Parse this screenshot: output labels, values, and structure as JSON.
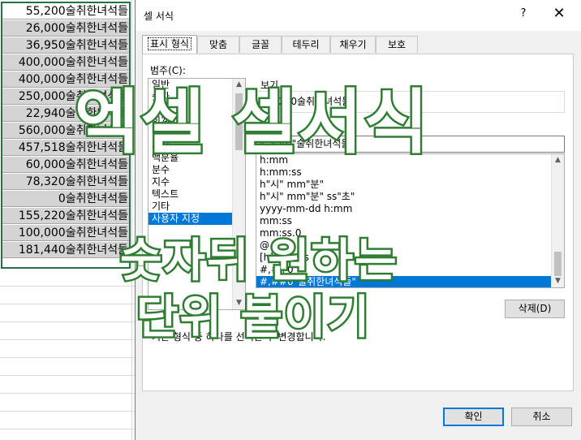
{
  "sheet": {
    "cells": [
      "55,200술취한녀석들",
      "26,000술취한녀석들",
      "36,950술취한녀석들",
      "400,000술취한녀석들",
      "400,000술취한녀석들",
      "250,000술취한녀석들",
      "22,940술취한녀석들",
      "560,000술취한녀석들",
      "457,518술취한녀석들",
      "60,000술취한녀석들",
      "78,320술취한녀석들",
      "0술취한녀석들",
      "155,220술취한녀석들",
      "100,000술취한녀석들",
      "181,440술취한녀석들"
    ]
  },
  "dialog": {
    "title": "셀 서식",
    "help_label": "?",
    "close_label": "✕",
    "tabs": [
      "표시 형식",
      "맞춤",
      "글꼴",
      "테두리",
      "채우기",
      "보호"
    ],
    "category_label": "범주(C):",
    "categories": [
      "일반",
      "숫자",
      "통화",
      "회계",
      "날짜",
      "시간",
      "백분율",
      "분수",
      "지수",
      "텍스트",
      "기타",
      "사용자 지정"
    ],
    "sample_label": "보기",
    "sample_value": "55,200술취한녀석들",
    "type_label": "형식(T):",
    "type_value": "#,##0\"술취한녀석들\"",
    "formats": [
      "h:mm",
      "h:mm:ss",
      "h\"시\" mm\"분\"",
      "h\"시\" mm\"분\" ss\"초\"",
      "yyyy-mm-dd h:mm",
      "mm:ss",
      "mm:ss.0",
      "@",
      "[h]:mm:ss",
      "#,##0",
      "#,##0\"술취한녀석들\""
    ],
    "delete_label": "삭제(D)",
    "hint": "기존 형식 중 하나를 선택한 후 변경합니다.",
    "ok_label": "확인",
    "cancel_label": "취소"
  },
  "overlay": {
    "line1": "엑셀 셀서식",
    "line2": "숫자뒤 원하는",
    "line3": "단위 붙이기",
    "stroke_color": "#2e7d32",
    "fill_color": "#ffffff"
  },
  "colors": {
    "selection": "#0078d7",
    "excel_green": "#217346"
  }
}
